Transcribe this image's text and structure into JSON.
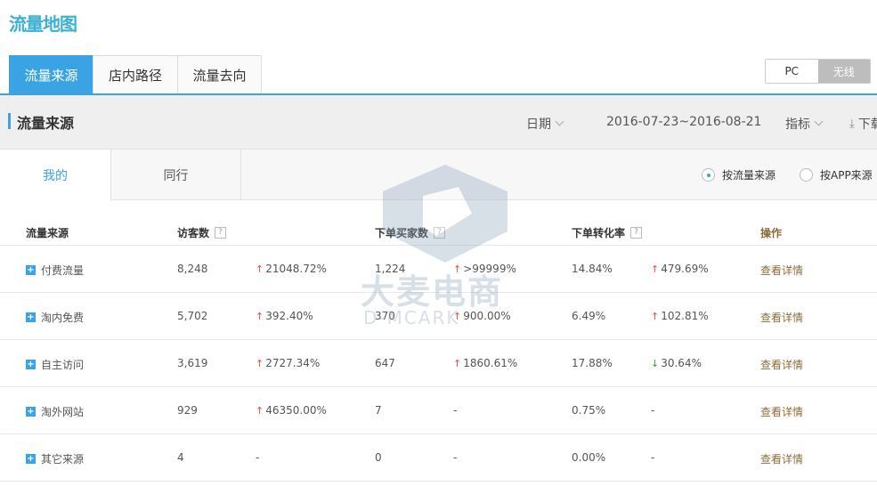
{
  "page_title": "流量地图",
  "top_tabs": [
    "流量来源",
    "店内路径",
    "流量去向"
  ],
  "device_toggle": {
    "pc": "PC",
    "wireless": "无线",
    "active": "wireless"
  },
  "filter_bar": {
    "title": "流量来源",
    "date_label": "日期",
    "date_range": "2016-07-23~2016-08-21",
    "metrics_label": "指标",
    "download_label": "下载"
  },
  "sub_tabs": [
    "我的",
    "同行"
  ],
  "radio_options": [
    {
      "label": "按流量来源",
      "checked": true
    },
    {
      "label": "按APP来源",
      "checked": false
    }
  ],
  "table": {
    "headers": {
      "source": "流量来源",
      "visitors": "访客数",
      "buyers": "下单买家数",
      "conversion": "下单转化率",
      "action": "操作"
    },
    "help_icon": "?",
    "rows": [
      {
        "source": "付费流量",
        "visitors": "8,248",
        "visitors_change": "21048.72%",
        "visitors_dir": "up",
        "buyers": "1,224",
        "buyers_change": ">99999%",
        "buyers_dir": "up",
        "conversion": "14.84%",
        "conversion_change": "479.69%",
        "conversion_dir": "up",
        "action": "查看详情"
      },
      {
        "source": "淘内免费",
        "visitors": "5,702",
        "visitors_change": "392.40%",
        "visitors_dir": "up",
        "buyers": "370",
        "buyers_change": "900.00%",
        "buyers_dir": "up",
        "conversion": "6.49%",
        "conversion_change": "102.81%",
        "conversion_dir": "up",
        "action": "查看详情"
      },
      {
        "source": "自主访问",
        "visitors": "3,619",
        "visitors_change": "2727.34%",
        "visitors_dir": "up",
        "buyers": "647",
        "buyers_change": "1860.61%",
        "buyers_dir": "up",
        "conversion": "17.88%",
        "conversion_change": "30.64%",
        "conversion_dir": "down",
        "action": "查看详情"
      },
      {
        "source": "淘外网站",
        "visitors": "929",
        "visitors_change": "46350.00%",
        "visitors_dir": "up",
        "buyers": "7",
        "buyers_change": "-",
        "buyers_dir": "none",
        "conversion": "0.75%",
        "conversion_change": "-",
        "conversion_dir": "none",
        "action": "查看详情"
      },
      {
        "source": "其它来源",
        "visitors": "4",
        "visitors_change": "-",
        "visitors_dir": "none",
        "buyers": "0",
        "buyers_change": "-",
        "buyers_dir": "none",
        "conversion": "0.00%",
        "conversion_change": "-",
        "conversion_dir": "none",
        "action": "查看详情"
      }
    ]
  },
  "watermark": {
    "text": "大麦电商",
    "sub": "D-MCARK"
  },
  "colors": {
    "accent": "#3aa3e3",
    "title": "#3ab0d4",
    "up": "#e84c3d",
    "down": "#3c9a2f",
    "action": "#8a6d3b"
  }
}
